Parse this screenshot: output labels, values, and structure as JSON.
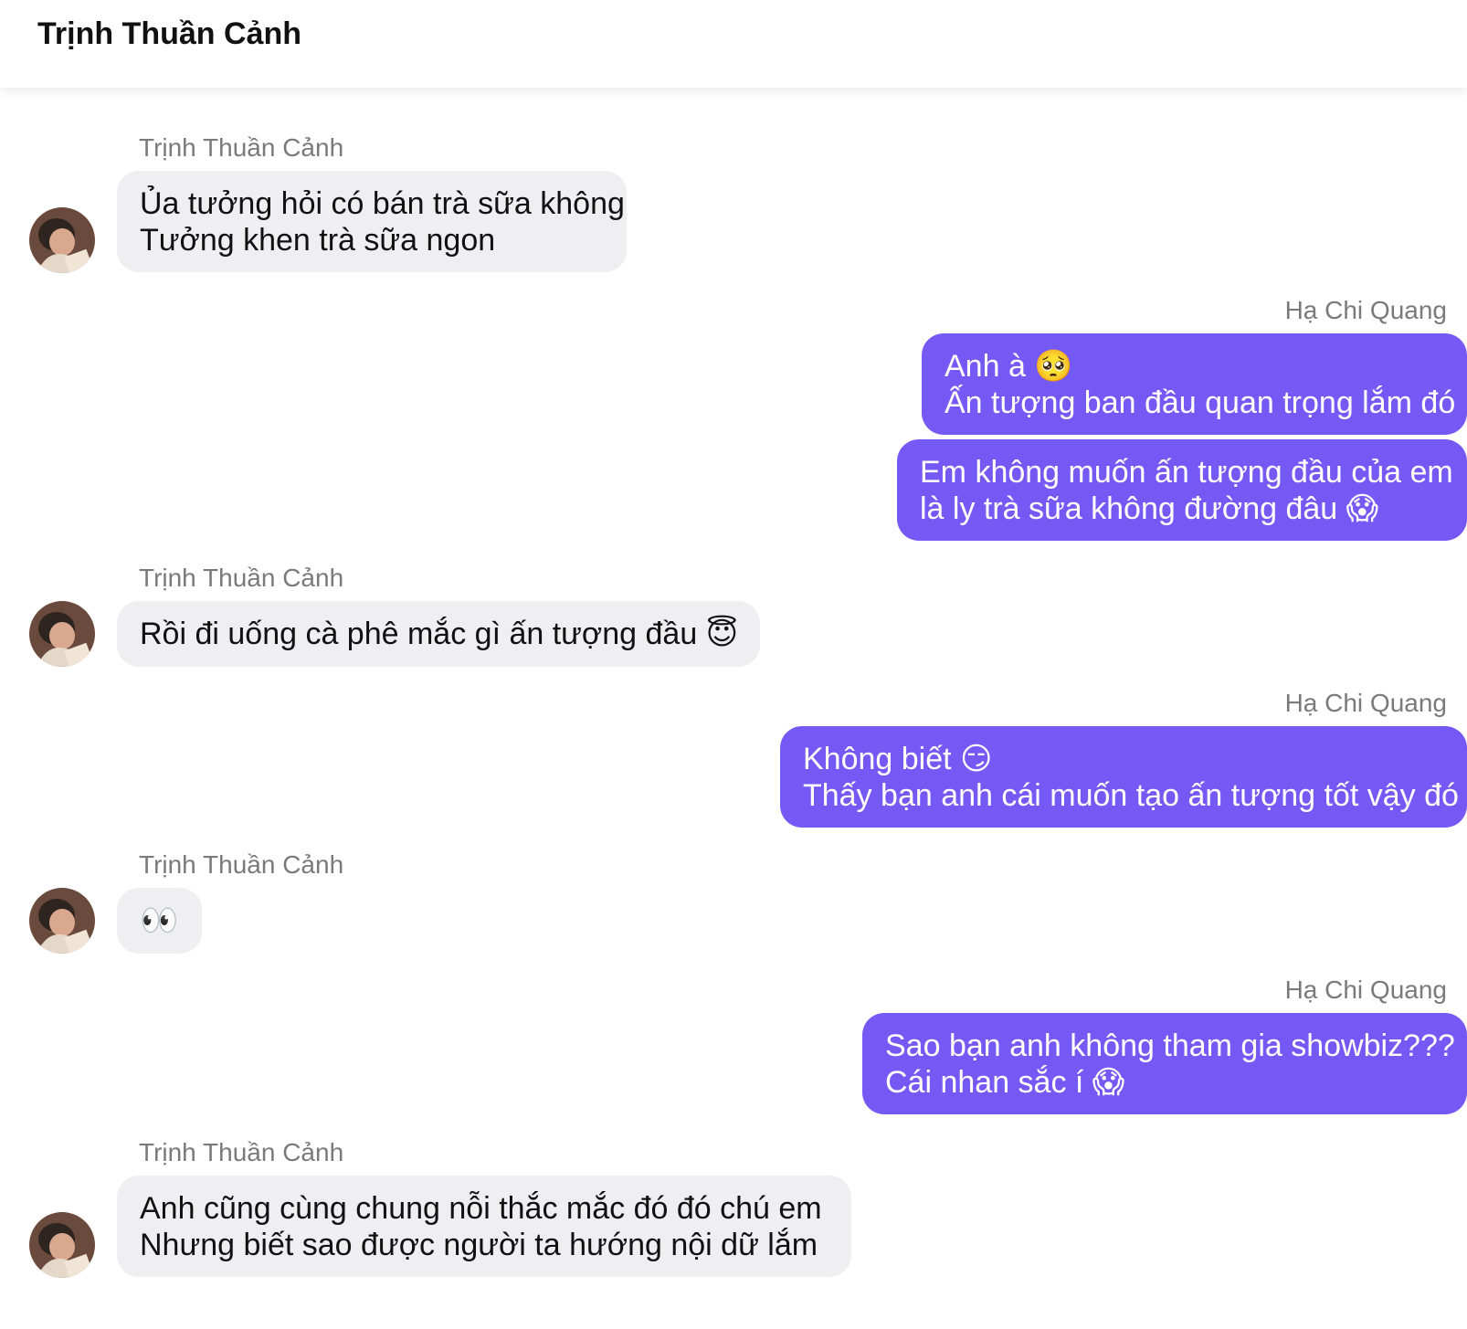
{
  "header": {
    "title": "Trịnh Thuần Cảnh"
  },
  "contacts": {
    "them": "Trịnh Thuần Cảnh",
    "me": "Hạ Chi Quang"
  },
  "messages": [
    {
      "sender": "Trịnh Thuần Cảnh",
      "lines": [
        "Ủa tưởng hỏi có bán trà sữa không",
        "Tưởng khen trà sữa ngon"
      ]
    },
    {
      "sender": "Hạ Chi Quang",
      "lines": [
        "Anh à 🥺",
        "Ấn tượng ban đầu quan trọng lắm đó"
      ]
    },
    {
      "sender": "Hạ Chi Quang",
      "lines": [
        "Em không muốn ấn tượng đầu của em",
        "là ly trà sữa không đường đâu 😱"
      ]
    },
    {
      "sender": "Trịnh Thuần Cảnh",
      "lines": [
        "Rồi đi uống cà phê mắc gì ấn tượng đầu 😇"
      ]
    },
    {
      "sender": "Hạ Chi Quang",
      "lines": [
        "Không biết 😏",
        "Thấy bạn anh cái muốn tạo ấn tượng tốt vậy đó"
      ]
    },
    {
      "sender": "Trịnh Thuần Cảnh",
      "lines": [
        "👀"
      ]
    },
    {
      "sender": "Hạ Chi Quang",
      "lines": [
        "Sao bạn anh không tham gia showbiz???",
        "Cái nhan sắc í 😱"
      ]
    },
    {
      "sender": "Trịnh Thuần Cảnh",
      "lines": [
        "Anh cũng cùng chung nỗi thắc mắc đó đó chú em",
        "Nhưng biết sao được người ta hướng nội dữ lắm"
      ]
    }
  ],
  "colors": {
    "outgoing_bubble": "#7559f4",
    "incoming_bubble": "#efeff1",
    "sender_name": "#7a7a7a"
  }
}
